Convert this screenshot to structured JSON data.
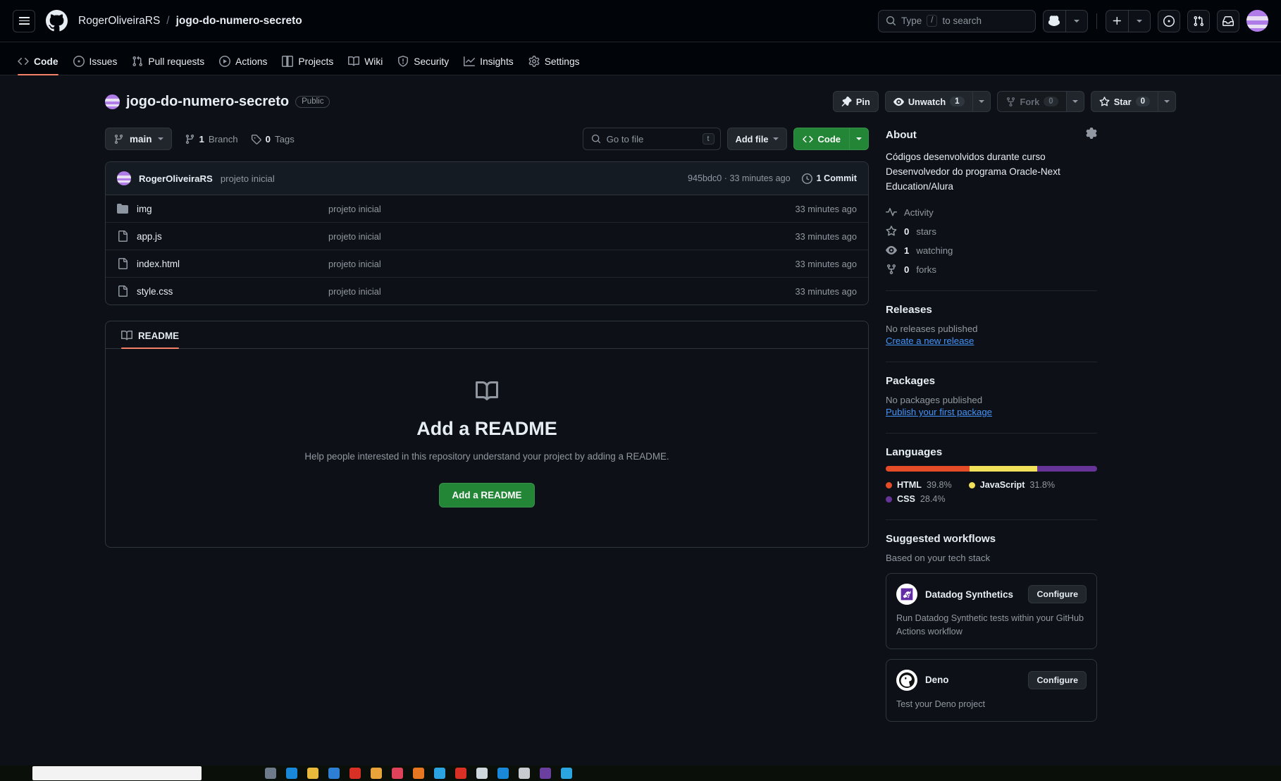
{
  "header": {
    "menu_icon": "hamburger-icon",
    "logo_icon": "github-mark-icon",
    "owner": "RogerOliveiraRS",
    "separator": "/",
    "repo": "jogo-do-numero-secreto",
    "search_placeholder": "Type / to search",
    "search_value": "",
    "search_kbd": "/",
    "copilot_icon": "copilot-icon",
    "create_new_icon": "plus-icon",
    "issues_icon": "issue-opened-icon",
    "pull_requests_icon": "git-pull-request-icon",
    "inbox_icon": "inbox-icon",
    "avatar_label": "user-avatar"
  },
  "repo_nav": [
    {
      "label": "Code",
      "icon": "code-icon",
      "selected": true
    },
    {
      "label": "Issues",
      "icon": "issue-opened-icon",
      "selected": false
    },
    {
      "label": "Pull requests",
      "icon": "git-pull-request-icon",
      "selected": false
    },
    {
      "label": "Actions",
      "icon": "play-icon",
      "selected": false
    },
    {
      "label": "Projects",
      "icon": "table-icon",
      "selected": false
    },
    {
      "label": "Wiki",
      "icon": "book-icon",
      "selected": false
    },
    {
      "label": "Security",
      "icon": "shield-icon",
      "selected": false
    },
    {
      "label": "Insights",
      "icon": "graph-icon",
      "selected": false
    },
    {
      "label": "Settings",
      "icon": "gear-icon",
      "selected": false
    }
  ],
  "repo_header": {
    "name": "jogo-do-numero-secreto",
    "visibility": "Public",
    "pin_label": "Pin",
    "watch_label": "Unwatch",
    "watch_count": "1",
    "fork_label": "Fork",
    "fork_count": "0",
    "star_label": "Star",
    "star_count": "0"
  },
  "file_toolbar": {
    "branch": "main",
    "branch_count": "1",
    "branch_word": "Branch",
    "tag_count": "0",
    "tag_word": "Tags",
    "go_to_file_placeholder": "Go to file",
    "go_to_file_value": "",
    "go_to_file_kbd": "t",
    "add_file_label": "Add file",
    "code_label": "Code"
  },
  "latest_commit": {
    "author": "RogerOliveiraRS",
    "message": "projeto inicial",
    "sha": "945bdc0",
    "sha_sep": "·",
    "time": "33 minutes ago",
    "commit_count_label": "1 Commit"
  },
  "files": [
    {
      "name": "img",
      "type": "folder",
      "commit": "projeto inicial",
      "time": "33 minutes ago"
    },
    {
      "name": "app.js",
      "type": "file",
      "commit": "projeto inicial",
      "time": "33 minutes ago"
    },
    {
      "name": "index.html",
      "type": "file",
      "commit": "projeto inicial",
      "time": "33 minutes ago"
    },
    {
      "name": "style.css",
      "type": "file",
      "commit": "projeto inicial",
      "time": "33 minutes ago"
    }
  ],
  "readme": {
    "tab_label": "README",
    "icon": "book-icon",
    "title": "Add a README",
    "subtitle": "Help people interested in this repository understand your project by adding a README.",
    "button_label": "Add a README"
  },
  "about": {
    "heading": "About",
    "settings_icon": "gear-icon",
    "description": "Códigos desenvolvidos durante curso Desenvolvedor do programa Oracle-Next Education/Alura",
    "items": [
      {
        "icon": "pulse-icon",
        "text": "Activity",
        "value": ""
      },
      {
        "icon": "star-icon",
        "value": "0",
        "text": "stars"
      },
      {
        "icon": "eye-icon",
        "value": "1",
        "text": "watching"
      },
      {
        "icon": "repo-forked-icon",
        "value": "0",
        "text": "forks"
      }
    ]
  },
  "releases": {
    "heading": "Releases",
    "empty_text": "No releases published",
    "link": "Create a new release"
  },
  "packages": {
    "heading": "Packages",
    "empty_text": "No packages published",
    "link": "Publish your first package"
  },
  "languages": {
    "heading": "Languages",
    "items": [
      {
        "name": "HTML",
        "percent": "39.8%",
        "value": 39.8,
        "color": "#e34c26"
      },
      {
        "name": "JavaScript",
        "percent": "31.8%",
        "value": 31.8,
        "color": "#f1e05a"
      },
      {
        "name": "CSS",
        "percent": "28.4%",
        "value": 28.4,
        "color": "#663399"
      }
    ]
  },
  "workflows": {
    "heading": "Suggested workflows",
    "subheading": "Based on your tech stack",
    "items": [
      {
        "name": "Datadog Synthetics",
        "logo": "datadog-logo-icon",
        "configure_label": "Configure",
        "description": "Run Datadog Synthetic tests within your GitHub Actions workflow"
      },
      {
        "name": "Deno",
        "logo": "deno-logo-icon",
        "configure_label": "Configure",
        "description": "Test your Deno project"
      }
    ]
  },
  "colors": {
    "accent_green": "#238636",
    "accent_orange": "#f78166",
    "link_blue": "#4493f8",
    "bg": "#0d1117",
    "header_bg": "#010409"
  }
}
